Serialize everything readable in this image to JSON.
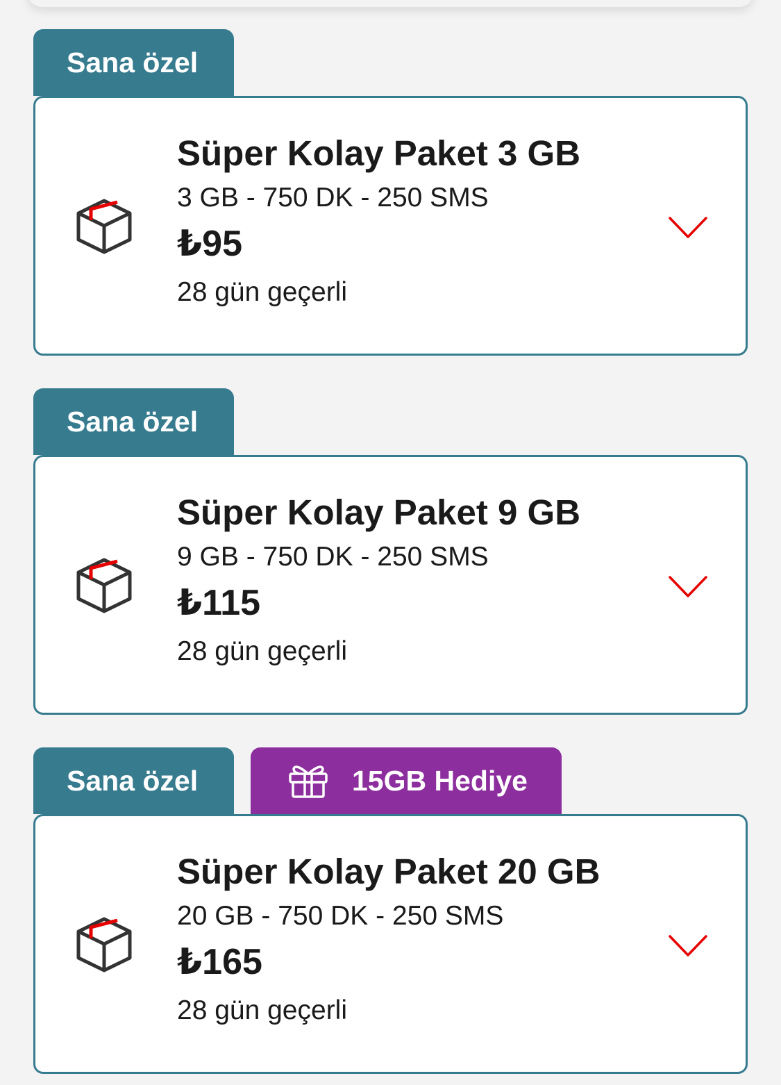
{
  "packages": [
    {
      "tag": "Sana özel",
      "title": "Süper Kolay Paket 3 GB",
      "details": "3 GB - 750 DK - 250 SMS",
      "price": "₺95",
      "validity": "28 gün geçerli"
    },
    {
      "tag": "Sana özel",
      "title": "Süper Kolay Paket 9 GB",
      "details": "9 GB - 750 DK - 250 SMS",
      "price": "₺115",
      "validity": "28 gün geçerli"
    },
    {
      "tag": "Sana özel",
      "gift": "15GB Hediye",
      "title": "Süper Kolay Paket 20 GB",
      "details": "20 GB - 750 DK - 250 SMS",
      "price": "₺165",
      "validity": "28 gün geçerli"
    }
  ],
  "colors": {
    "tag": "#377b8f",
    "gift": "#8c2e9d",
    "accent": "#e60000",
    "background": "#f3f3f3"
  },
  "icons": {
    "package": "package-box-icon",
    "expand": "chevron-down-icon",
    "gift": "gift-icon"
  }
}
